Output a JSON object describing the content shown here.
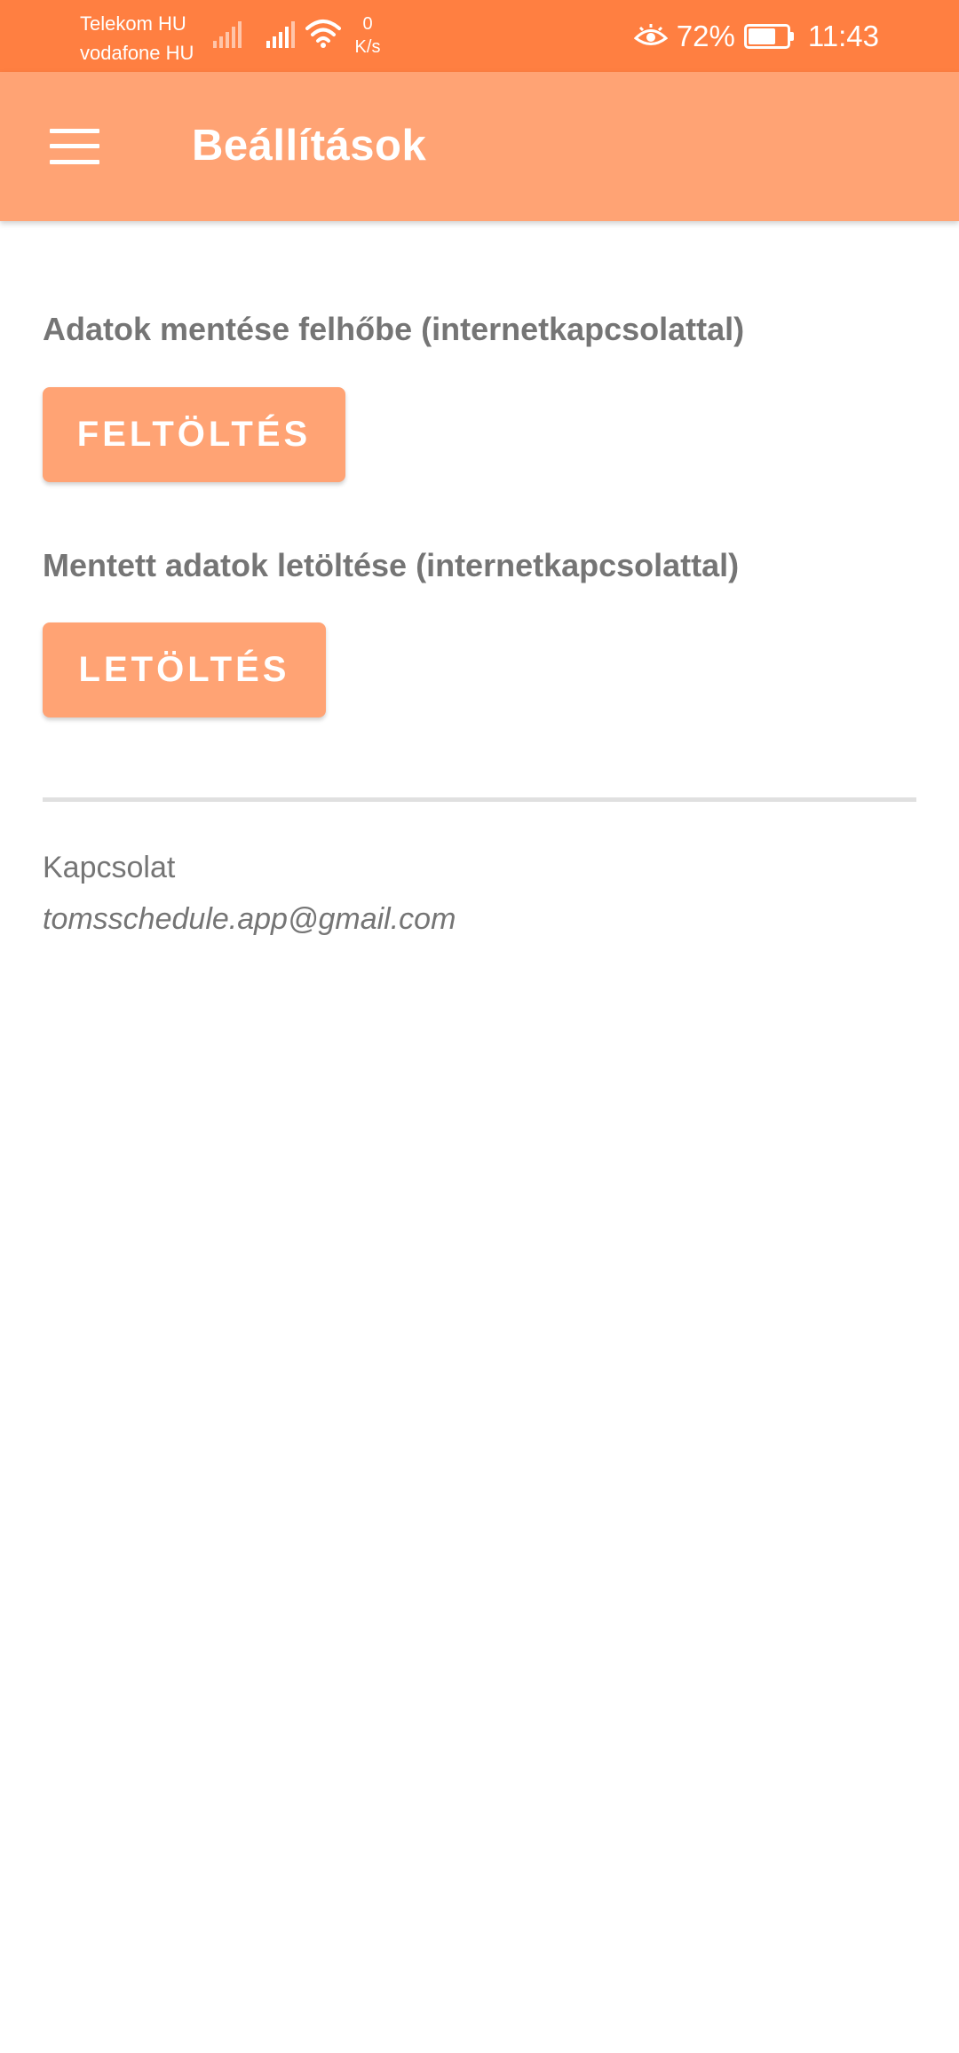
{
  "status_bar": {
    "carrier_1": "Telekom HU",
    "carrier_2": "vodafone HU",
    "net_speed_value": "0",
    "net_speed_unit": "K/s",
    "battery_percent": "72%",
    "battery_level": 0.72,
    "time": "11:43",
    "icons": [
      "signal-icon",
      "signal-icon",
      "wifi-icon",
      "eye-comfort-icon",
      "battery-icon"
    ]
  },
  "app_bar": {
    "menu_icon": "hamburger-menu-icon",
    "title": "Beállítások",
    "color": "#ffa374"
  },
  "upload": {
    "label": "Adatok mentése felhőbe (internetkapcsolattal)",
    "button": "FELTÖLTÉS"
  },
  "download": {
    "label": "Mentett adatok letöltése (internetkapcsolattal)",
    "button": "LETÖLTÉS"
  },
  "contact": {
    "label": "Kapcsolat",
    "email": "tomsschedule.app@gmail.com"
  },
  "colors": {
    "status_bar": "#ff7f41",
    "accent": "#ffa374",
    "text_secondary": "#757575"
  }
}
